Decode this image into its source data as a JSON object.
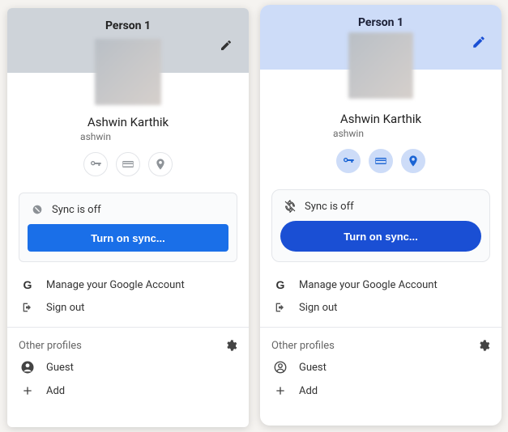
{
  "panels": [
    {
      "title": "Person 1",
      "name": "Ashwin Karthik",
      "email_prefix": "ashwin",
      "sync_status": "Sync is off",
      "sync_button": "Turn on sync...",
      "manage_label": "Manage your Google Account",
      "signout_label": "Sign out",
      "other_title": "Other profiles",
      "guest_label": "Guest",
      "add_label": "Add",
      "chips": [
        "key-icon",
        "card-icon",
        "pin-icon"
      ]
    },
    {
      "title": "Person 1",
      "name": "Ashwin Karthik",
      "email_prefix": "ashwin",
      "sync_status": "Sync is off",
      "sync_button": "Turn on sync...",
      "manage_label": "Manage your Google Account",
      "signout_label": "Sign out",
      "other_title": "Other profiles",
      "guest_label": "Guest",
      "add_label": "Add",
      "chips": [
        "key-icon",
        "card-icon",
        "pin-icon"
      ]
    }
  ]
}
